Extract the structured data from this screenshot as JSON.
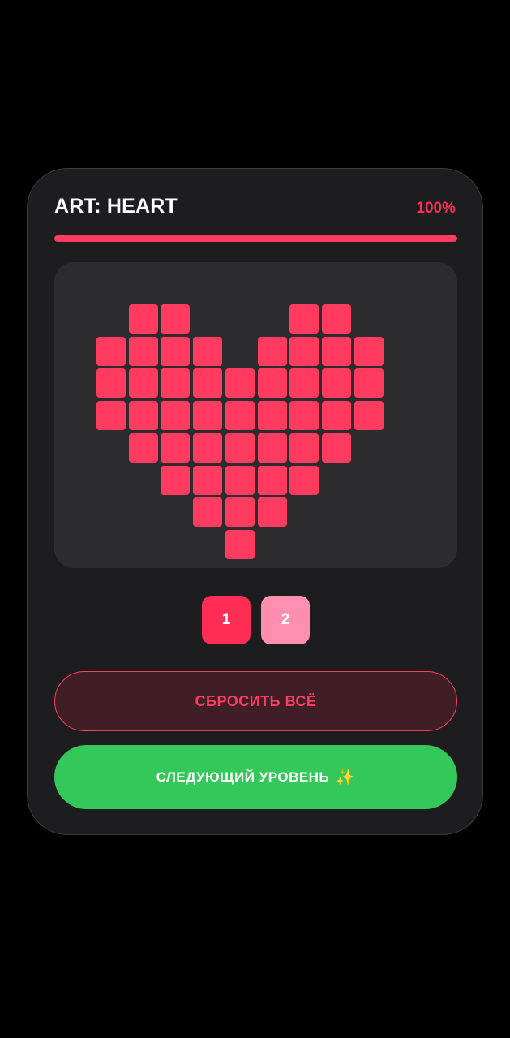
{
  "header": {
    "title": "ART: HEART",
    "percent_label": "100%",
    "progress": 1.0
  },
  "colors": {
    "accent": "#ff3b5f",
    "swatch_1": "#ff2d55",
    "swatch_2": "#ff8fb0",
    "next_button": "#34c759"
  },
  "grid": {
    "cols": 9,
    "rows": 8,
    "filled_rows": [
      [
        1,
        2,
        6,
        7
      ],
      [
        0,
        1,
        2,
        3,
        5,
        6,
        7,
        8
      ],
      [
        0,
        1,
        2,
        3,
        4,
        5,
        6,
        7,
        8
      ],
      [
        0,
        1,
        2,
        3,
        4,
        5,
        6,
        7,
        8
      ],
      [
        1,
        2,
        3,
        4,
        5,
        6,
        7
      ],
      [
        2,
        3,
        4,
        5,
        6
      ],
      [
        3,
        4,
        5
      ],
      [
        4
      ]
    ]
  },
  "palette": {
    "swatches": [
      {
        "label": "1",
        "color": "#ff2d55"
      },
      {
        "label": "2",
        "color": "#ff8fb0"
      }
    ]
  },
  "buttons": {
    "reset_label": "СБРОСИТЬ ВСЁ",
    "next_label": "СЛЕДУЮЩИЙ УРОВЕНЬ",
    "next_icon": "sparkles-icon"
  }
}
